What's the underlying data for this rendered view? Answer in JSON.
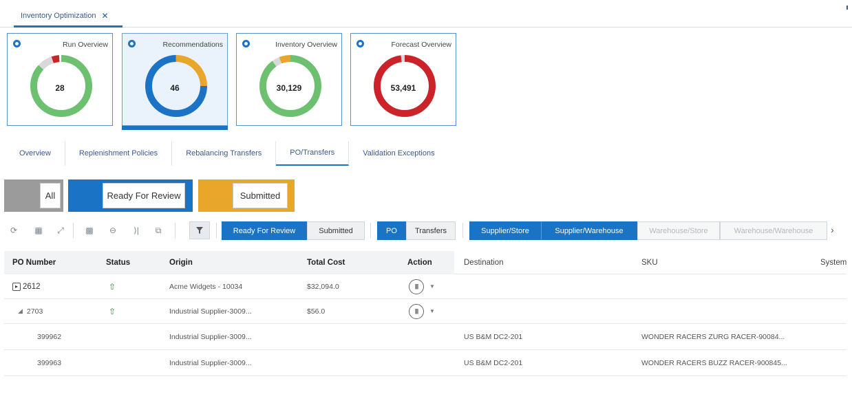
{
  "app_tab": {
    "label": "Inventory Optimization",
    "close": "✕"
  },
  "tiles": [
    {
      "title": "Run Overview",
      "value": "28"
    },
    {
      "title": "Recommendations",
      "value": "46"
    },
    {
      "title": "Inventory Overview",
      "value": "30,129"
    },
    {
      "title": "Forecast Overview",
      "value": "53,491"
    }
  ],
  "subtabs": [
    "Overview",
    "Replenishment Policies",
    "Rebalancing Transfers",
    "PO/Transfers",
    "Validation Exceptions"
  ],
  "status_filters": {
    "all": "All",
    "ready": "Ready For Review",
    "submitted": "Submitted"
  },
  "toolbar": {
    "ready": "Ready For Review",
    "submitted": "Submitted",
    "po": "PO",
    "transfers": "Transfers",
    "supplier_store": "Supplier/Store",
    "supplier_warehouse": "Supplier/Warehouse",
    "warehouse_store": "Warehouse/Store",
    "warehouse_warehouse": "Warehouse/Warehouse"
  },
  "table": {
    "headers": {
      "po_number": "PO Number",
      "status": "Status",
      "origin": "Origin",
      "total_cost": "Total Cost",
      "action": "Action",
      "destination": "Destination",
      "sku": "SKU",
      "system": "System"
    },
    "rows": [
      {
        "po": "2612",
        "origin": "Acme Widgets - 10034",
        "cost": "$32,094.0",
        "destination": "",
        "sku": ""
      },
      {
        "po": "2703",
        "origin": "Industrial Supplier-3009...",
        "cost": "$56.0",
        "destination": "",
        "sku": ""
      },
      {
        "po": "399962",
        "origin": "Industrial Supplier-3009...",
        "cost": "",
        "destination": "US B&M DC2-201",
        "sku": "WONDER RACERS ZURG RACER-90084..."
      },
      {
        "po": "399963",
        "origin": "Industrial Supplier-3009...",
        "cost": "",
        "destination": "US B&M DC2-201",
        "sku": "WONDER RACERS BUZZ RACER-900845..."
      }
    ]
  },
  "colors": {
    "accent": "#1a73c4",
    "green": "#6cc070",
    "orange": "#e8a72a",
    "red": "#cc2229",
    "grey": "#d9d9d9"
  }
}
